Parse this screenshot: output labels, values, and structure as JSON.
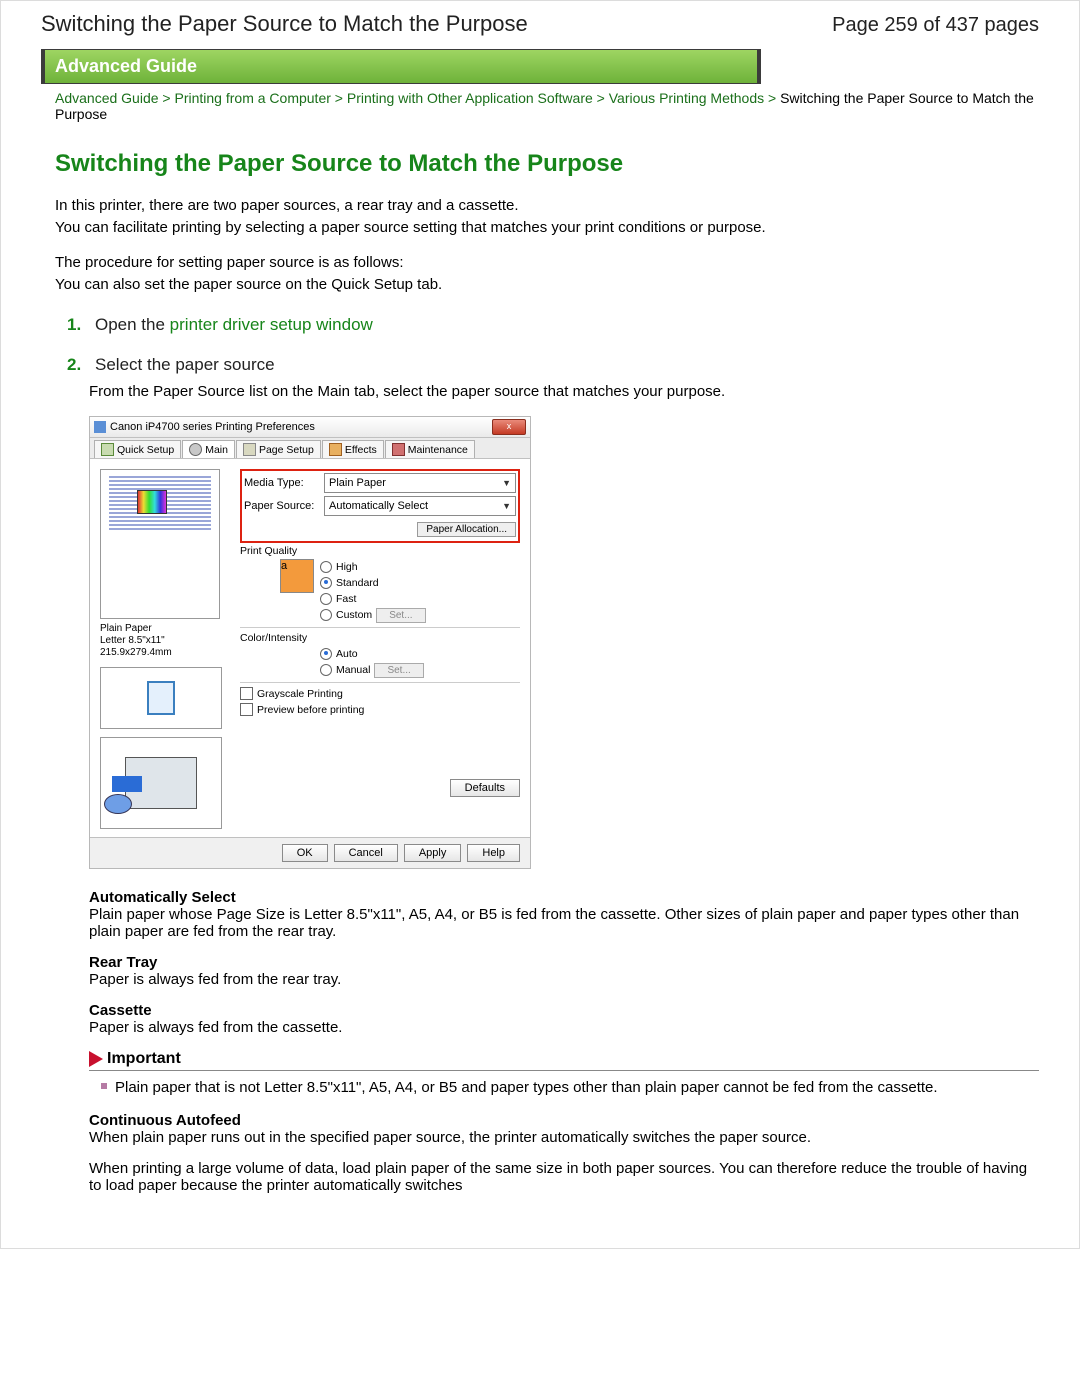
{
  "header": {
    "top_title": "Switching the Paper Source to Match the Purpose",
    "page_counter": "Page 259 of 437 pages",
    "banner": "Advanced Guide"
  },
  "breadcrumb": {
    "items": [
      "Advanced Guide",
      "Printing from a Computer",
      "Printing with Other Application Software",
      "Various Printing Methods"
    ],
    "current": "Switching the Paper Source to Match the Purpose",
    "sep": ">"
  },
  "title": "Switching the Paper Source to Match the Purpose",
  "intro": {
    "p1": "In this printer, there are two paper sources, a rear tray and a cassette.",
    "p2": "You can facilitate printing by selecting a paper source setting that matches your print conditions or purpose.",
    "p3": "The procedure for setting paper source is as follows:",
    "p4": "You can also set the paper source on the Quick Setup tab."
  },
  "steps": [
    {
      "num": "1.",
      "pre": "Open the ",
      "link": "printer driver setup window"
    },
    {
      "num": "2.",
      "text": "Select the paper source",
      "desc": "From the Paper Source list on the Main tab, select the paper source that matches your purpose."
    }
  ],
  "dialog": {
    "title": "Canon iP4700 series Printing Preferences",
    "close": "x",
    "tabs": {
      "quick": "Quick Setup",
      "main": "Main",
      "page": "Page Setup",
      "effects": "Effects",
      "maint": "Maintenance"
    },
    "labels": {
      "media": "Media Type:",
      "source": "Paper Source:",
      "quality": "Print Quality",
      "color": "Color/Intensity"
    },
    "values": {
      "media": "Plain Paper",
      "source": "Automatically Select"
    },
    "buttons": {
      "allocation": "Paper Allocation...",
      "set": "Set...",
      "defaults": "Defaults",
      "ok": "OK",
      "cancel": "Cancel",
      "apply": "Apply",
      "help": "Help"
    },
    "quality": {
      "high": "High",
      "standard": "Standard",
      "fast": "Fast",
      "custom": "Custom"
    },
    "color": {
      "auto": "Auto",
      "manual": "Manual"
    },
    "checks": {
      "gray": "Grayscale Printing",
      "preview": "Preview before printing"
    },
    "preview": {
      "paper": "Plain Paper",
      "size": "Letter 8.5\"x11\" 215.9x279.4mm"
    }
  },
  "defs": {
    "auto": {
      "t": "Automatically Select",
      "d": "Plain paper whose Page Size is Letter 8.5\"x11\", A5, A4, or B5 is fed from the cassette. Other sizes of plain paper and paper types other than plain paper are fed from the rear tray."
    },
    "rear": {
      "t": "Rear Tray",
      "d": "Paper is always fed from the rear tray."
    },
    "cass": {
      "t": "Cassette",
      "d": "Paper is always fed from the cassette."
    },
    "important": {
      "title": "Important",
      "d": "Plain paper that is not Letter 8.5\"x11\", A5, A4, or B5 and paper types other than plain paper cannot be fed from the cassette."
    },
    "cont": {
      "t": "Continuous Autofeed",
      "d1": "When plain paper runs out in the specified paper source, the printer automatically switches the paper source.",
      "d2": "When printing a large volume of data, load plain paper of the same size in both paper sources. You can therefore reduce the trouble of having to load paper because the printer automatically switches"
    }
  }
}
